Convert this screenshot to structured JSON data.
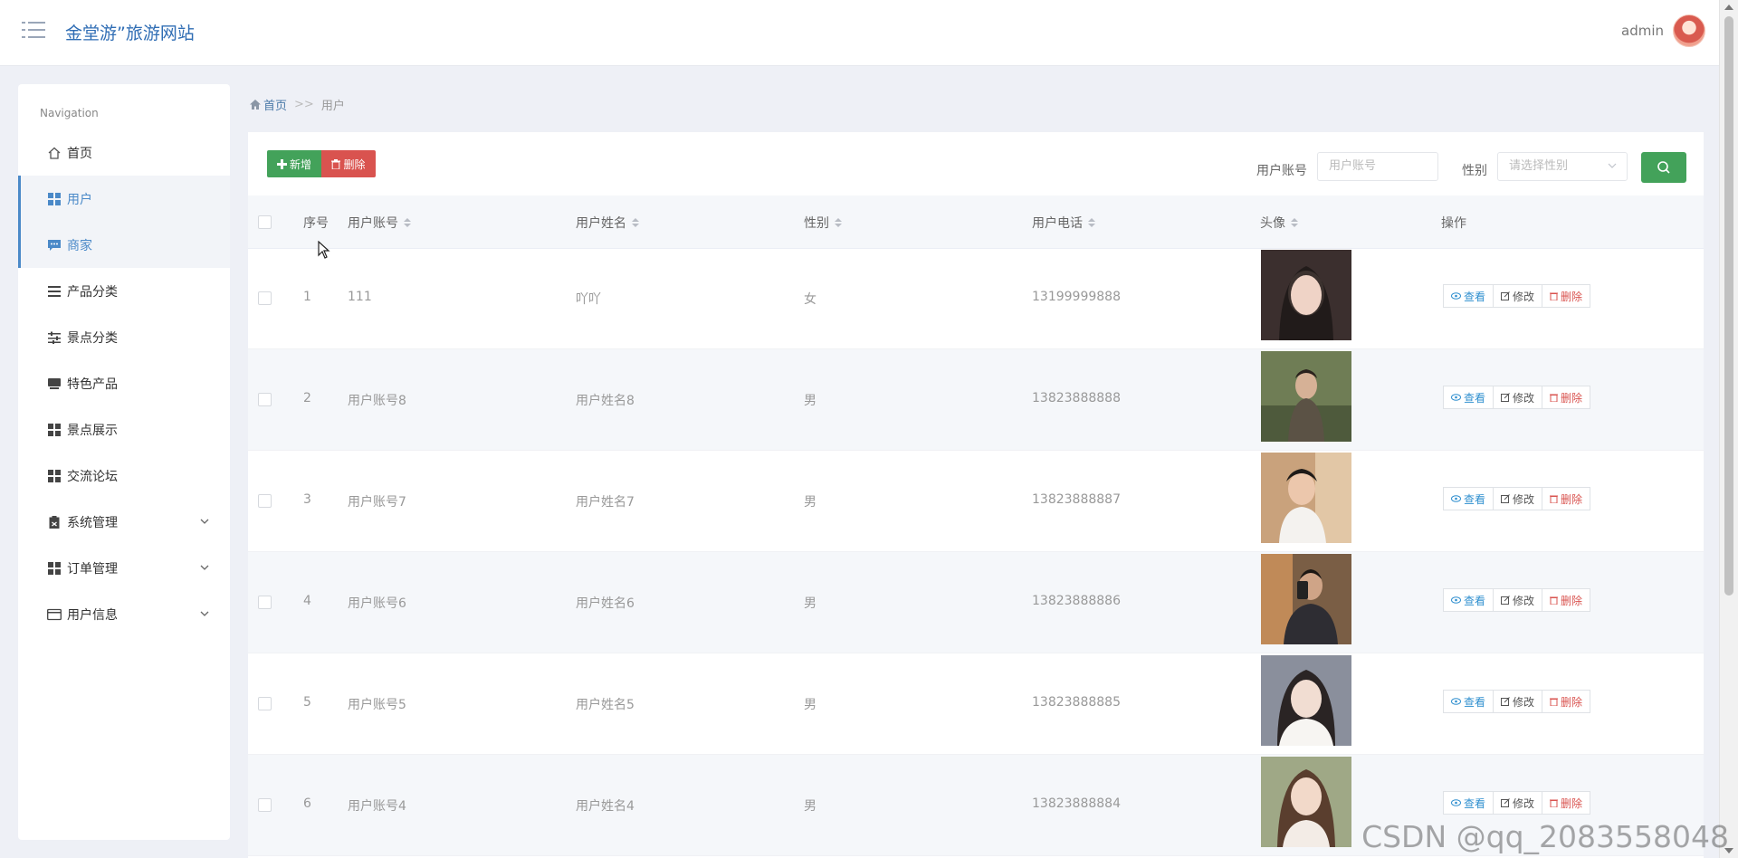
{
  "header": {
    "site_title": "金堂游”旅游网站",
    "username": "admin"
  },
  "sidebar": {
    "heading": "Navigation",
    "items": [
      {
        "label": "首页",
        "icon": "home-icon",
        "state": "normal",
        "expandable": false
      },
      {
        "label": "用户",
        "icon": "grid-icon",
        "state": "active",
        "expandable": false
      },
      {
        "label": "商家",
        "icon": "chat-icon",
        "state": "active",
        "expandable": false
      },
      {
        "label": "产品分类",
        "icon": "list-icon",
        "state": "normal",
        "expandable": false
      },
      {
        "label": "景点分类",
        "icon": "sliders-icon",
        "state": "normal",
        "expandable": false
      },
      {
        "label": "特色产品",
        "icon": "tray-icon",
        "state": "normal",
        "expandable": false
      },
      {
        "label": "景点展示",
        "icon": "grid-icon",
        "state": "normal",
        "expandable": false
      },
      {
        "label": "交流论坛",
        "icon": "grid-icon",
        "state": "normal",
        "expandable": false
      },
      {
        "label": "系统管理",
        "icon": "clipboard-icon",
        "state": "normal",
        "expandable": true
      },
      {
        "label": "订单管理",
        "icon": "grid-icon",
        "state": "normal",
        "expandable": true
      },
      {
        "label": "用户信息",
        "icon": "card-icon",
        "state": "normal",
        "expandable": true
      }
    ]
  },
  "breadcrumb": {
    "home": "首页",
    "separator": ">>",
    "current": "用户"
  },
  "toolbar": {
    "add_label": "新增",
    "delete_label": "删除",
    "filter_account_label": "用户账号",
    "filter_account_placeholder": "用户账号",
    "filter_gender_label": "性别",
    "filter_gender_placeholder": "请选择性别"
  },
  "table": {
    "headers": {
      "index": "序号",
      "account": "用户账号",
      "name": "用户姓名",
      "gender": "性别",
      "phone": "用户电话",
      "avatar": "头像",
      "actions": "操作"
    },
    "rows": [
      {
        "index": "1",
        "account": "111",
        "name": "吖吖",
        "gender": "女",
        "phone": "13199999888"
      },
      {
        "index": "2",
        "account": "用户账号8",
        "name": "用户姓名8",
        "gender": "男",
        "phone": "13823888888"
      },
      {
        "index": "3",
        "account": "用户账号7",
        "name": "用户姓名7",
        "gender": "男",
        "phone": "13823888887"
      },
      {
        "index": "4",
        "account": "用户账号6",
        "name": "用户姓名6",
        "gender": "男",
        "phone": "13823888886"
      },
      {
        "index": "5",
        "account": "用户账号5",
        "name": "用户姓名5",
        "gender": "男",
        "phone": "13823888885"
      },
      {
        "index": "6",
        "account": "用户账号4",
        "name": "用户姓名4",
        "gender": "男",
        "phone": "13823888884"
      }
    ],
    "action_labels": {
      "view": "查看",
      "edit": "修改",
      "delete": "删除"
    }
  },
  "watermark": "CSDN @qq_2083558048",
  "colors": {
    "primary_green": "#43a25a",
    "danger_red": "#d9534f",
    "link_blue": "#2f8fcf",
    "title_blue": "#2f6db4",
    "active_nav": "#4a89c8"
  }
}
